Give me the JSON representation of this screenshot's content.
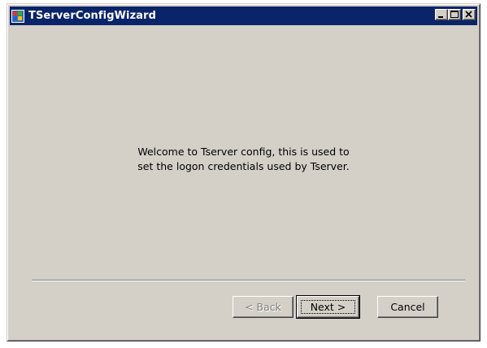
{
  "window": {
    "title": "TServerConfigWizard",
    "app_icon": "windows-app-icon",
    "title_buttons": {
      "minimize": "minimize-icon",
      "maximize": "maximize-icon",
      "close": "close-icon"
    },
    "title_bar_color": "#0a246a",
    "face_color": "#d4d0c8"
  },
  "content": {
    "welcome_line_1": "Welcome to Tserver config, this is used to",
    "welcome_line_2": "set the logon credentials used by Tserver."
  },
  "buttons": {
    "back_label": "< Back",
    "back_enabled": false,
    "next_label": "Next >",
    "next_default": true,
    "cancel_label": "Cancel"
  }
}
